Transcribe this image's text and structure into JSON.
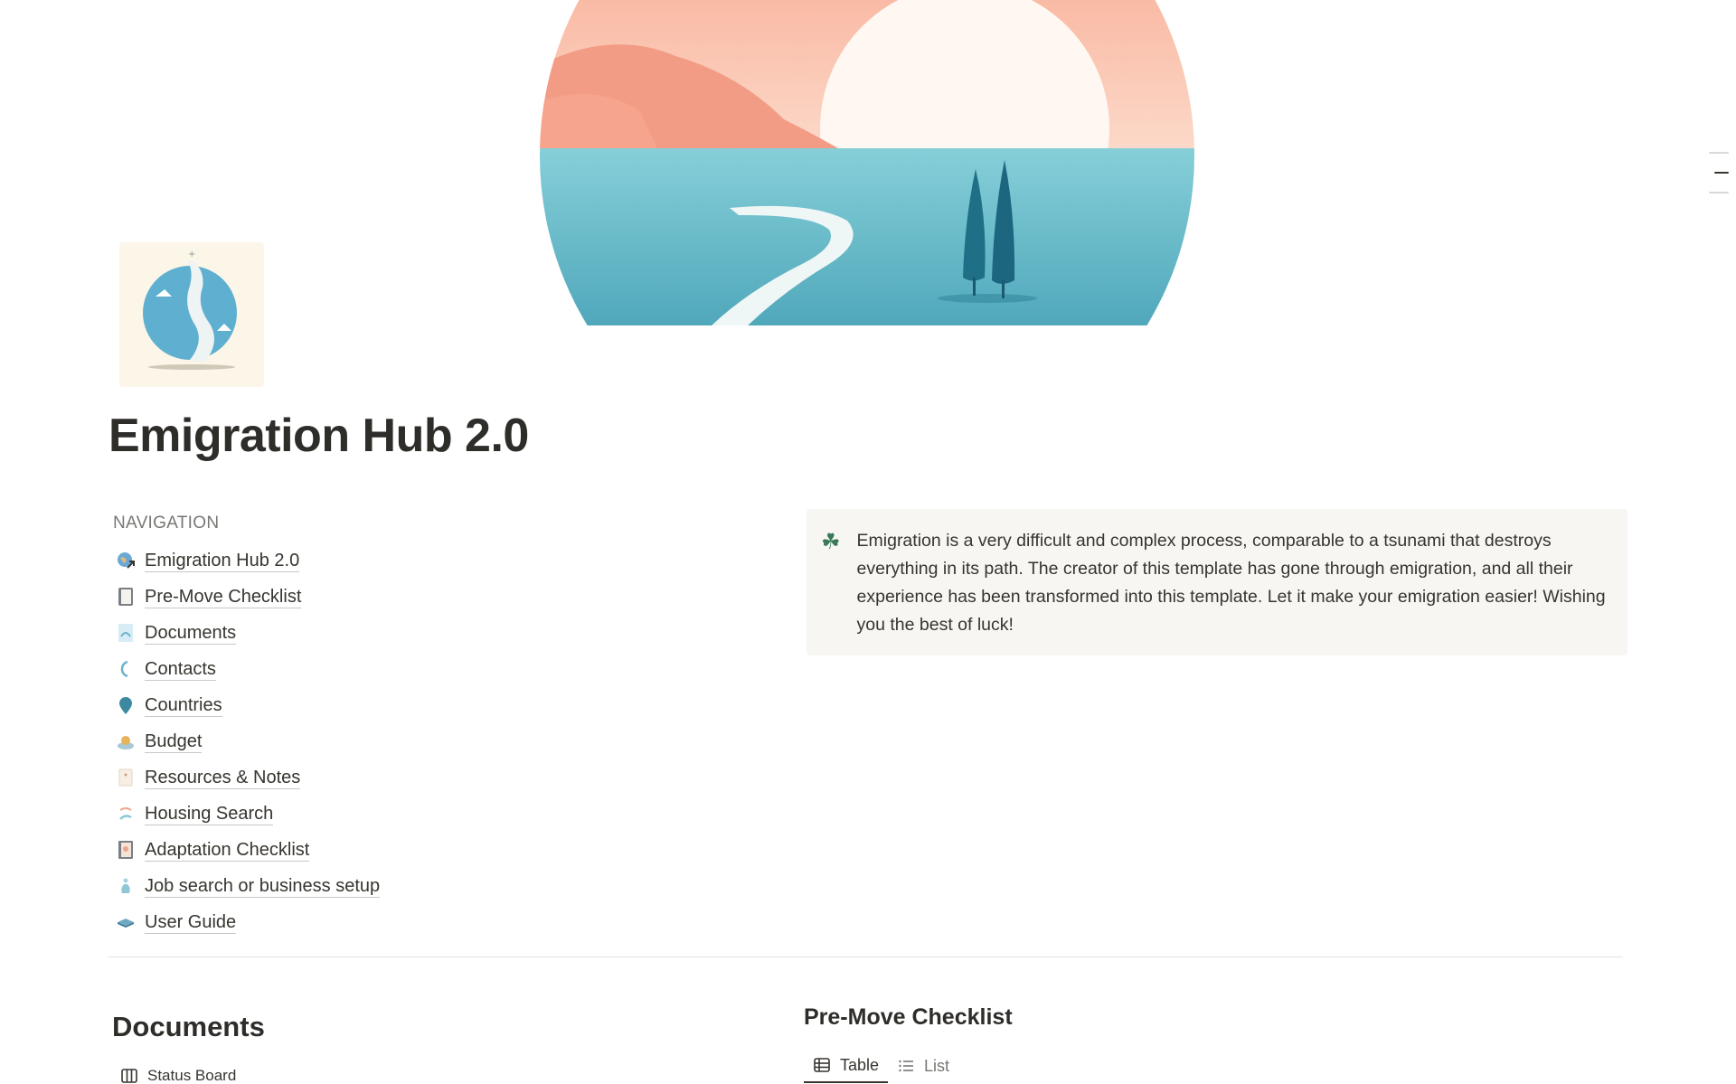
{
  "page": {
    "title": "Emigration Hub 2.0"
  },
  "navigation": {
    "heading": "NAVIGATION",
    "items": [
      {
        "label": "Emigration Hub 2.0",
        "icon": "globe-link-icon"
      },
      {
        "label": "Pre-Move Checklist",
        "icon": "notebook-icon"
      },
      {
        "label": "Documents",
        "icon": "document-icon"
      },
      {
        "label": "Contacts",
        "icon": "phone-icon"
      },
      {
        "label": "Countries",
        "icon": "map-pin-icon"
      },
      {
        "label": "Budget",
        "icon": "money-icon"
      },
      {
        "label": "Resources & Notes",
        "icon": "note-icon"
      },
      {
        "label": "Housing Search",
        "icon": "house-icon"
      },
      {
        "label": "Adaptation Checklist",
        "icon": "checklist-icon"
      },
      {
        "label": "Job search or business setup",
        "icon": "briefcase-icon"
      },
      {
        "label": "User Guide",
        "icon": "book-icon"
      }
    ]
  },
  "callout": {
    "icon": "clover-icon",
    "text": "Emigration is a very difficult and complex process, comparable to a tsunami that destroys everything in its path. The creator of this template has gone through emigration, and all their experience has been transformed into this template. Let it make your emigration easier! Wishing you the best of luck!"
  },
  "documents": {
    "heading": "Documents",
    "view_label": "Status Board"
  },
  "premove": {
    "heading": "Pre-Move Checklist",
    "tabs": [
      {
        "label": "Table",
        "active": true
      },
      {
        "label": "List",
        "active": false
      }
    ]
  },
  "colors": {
    "sky": "#fbd3c0",
    "sun": "#fff8f2",
    "mountain": "#f4a48c",
    "water": "#7fc8d3",
    "tree": "#1f6f86",
    "callout_bg": "#f7f6f3"
  }
}
